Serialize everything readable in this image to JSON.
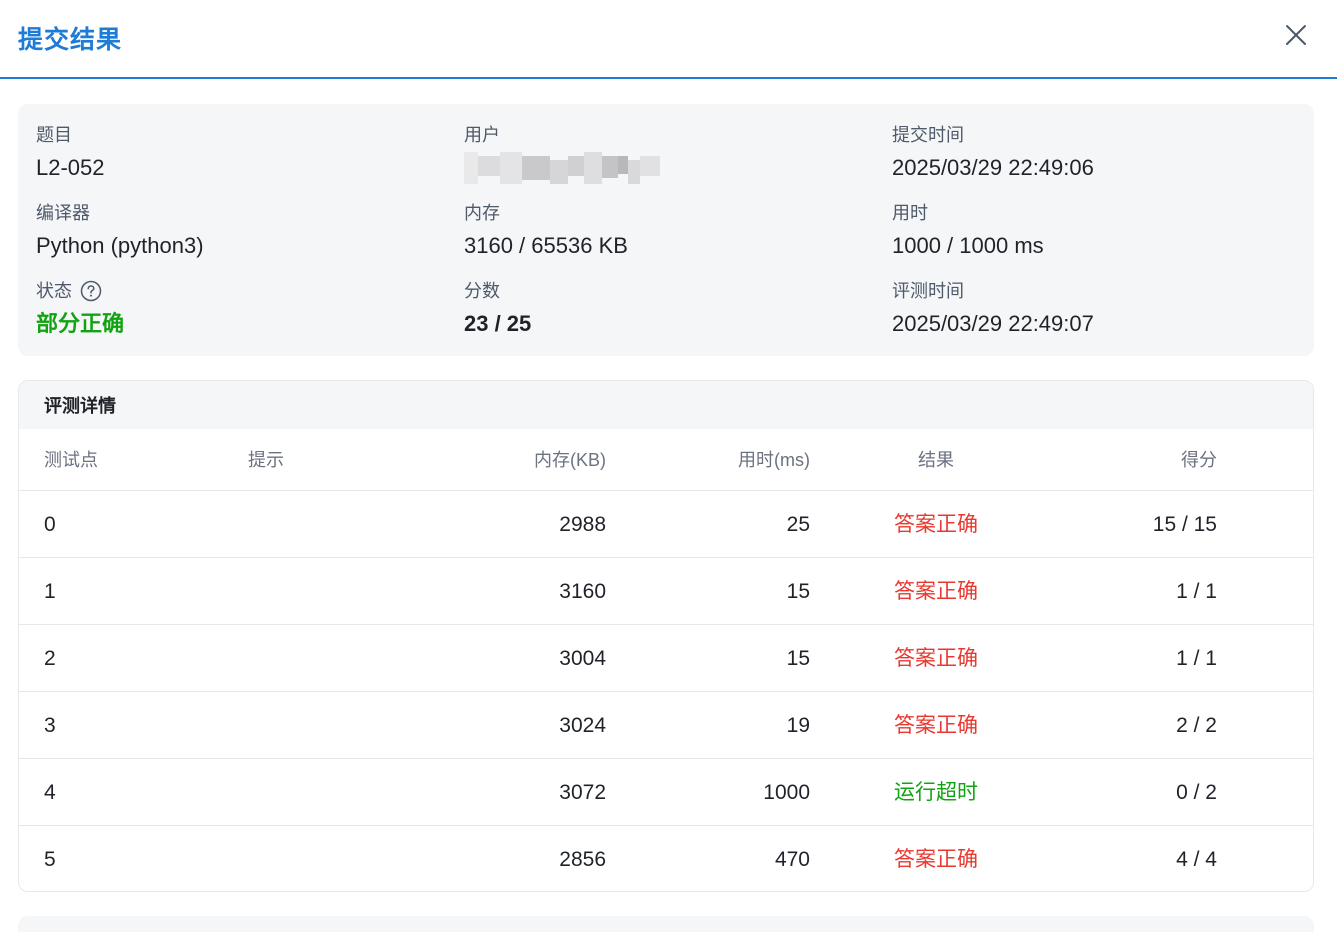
{
  "header": {
    "title": "提交结果"
  },
  "info": {
    "problem": {
      "label": "题目",
      "value": "L2-052"
    },
    "user": {
      "label": "用户"
    },
    "submit_time": {
      "label": "提交时间",
      "value": "2025/03/29 22:49:06"
    },
    "compiler": {
      "label": "编译器",
      "value": "Python (python3)"
    },
    "memory": {
      "label": "内存",
      "value": "3160 / 65536 KB"
    },
    "time_used": {
      "label": "用时",
      "value": "1000 / 1000 ms"
    },
    "status": {
      "label": "状态",
      "value": "部分正确",
      "color": "#12a312"
    },
    "score": {
      "label": "分数",
      "value": "23 / 25"
    },
    "judge_time": {
      "label": "评测时间",
      "value": "2025/03/29 22:49:07"
    }
  },
  "details": {
    "title": "评测详情",
    "columns": [
      "测试点",
      "提示",
      "内存(KB)",
      "用时(ms)",
      "结果",
      "得分"
    ],
    "rows": [
      {
        "case": "0",
        "hint": "",
        "memory": "2988",
        "time": "25",
        "result": "答案正确",
        "score": "15 / 15"
      },
      {
        "case": "1",
        "hint": "",
        "memory": "3160",
        "time": "15",
        "result": "答案正确",
        "score": "1 / 1"
      },
      {
        "case": "2",
        "hint": "",
        "memory": "3004",
        "time": "15",
        "result": "答案正确",
        "score": "1 / 1"
      },
      {
        "case": "3",
        "hint": "",
        "memory": "3024",
        "time": "19",
        "result": "答案正确",
        "score": "2 / 2"
      },
      {
        "case": "4",
        "hint": "",
        "memory": "3072",
        "time": "1000",
        "result": "运行超时",
        "score": "0 / 2"
      },
      {
        "case": "5",
        "hint": "",
        "memory": "2856",
        "time": "470",
        "result": "答案正确",
        "score": "4 / 4"
      }
    ]
  },
  "colors": {
    "accent": "#1e7bd6",
    "accepted": "#e8382f",
    "timeout": "#12a312"
  }
}
